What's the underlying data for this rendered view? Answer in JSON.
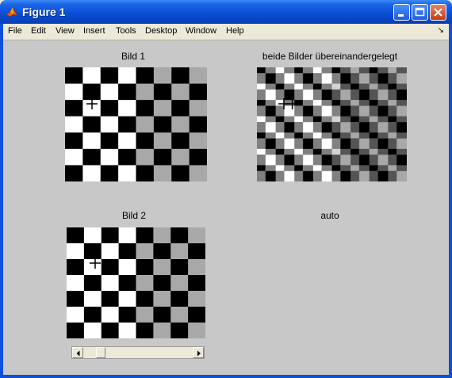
{
  "window": {
    "title": "Figure 1"
  },
  "menu": [
    "File",
    "Edit",
    "View",
    "Insert",
    "Tools",
    "Desktop",
    "Window",
    "Help"
  ],
  "plots": {
    "bild1_title": "Bild 1",
    "overlay_title": "beide Bilder übereinandergelegt",
    "bild2_title": "Bild 2",
    "auto_label": "auto"
  },
  "slider": {
    "position_fraction": 0.13
  },
  "colors": {
    "black": "#000000",
    "white": "#ffffff",
    "gray": "#a8a8a8",
    "dark_gray": "#555555",
    "figure_bg": "#c8c8c8"
  }
}
